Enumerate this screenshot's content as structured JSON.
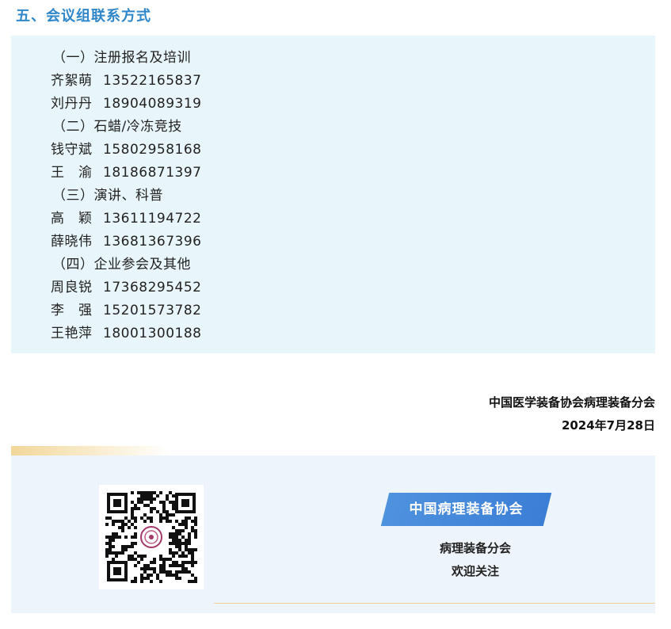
{
  "section_title": "五、会议组联系方式",
  "contacts": [
    {
      "type": "category",
      "text": "（一）注册报名及培训"
    },
    {
      "type": "person",
      "name": "齐絮萌",
      "phone": "13522165837"
    },
    {
      "type": "person",
      "name": "刘丹丹",
      "phone": "18904089319"
    },
    {
      "type": "category",
      "text": "（二）石蜡/冷冻竞技"
    },
    {
      "type": "person",
      "name": "钱守斌",
      "phone": "15802958168"
    },
    {
      "type": "person",
      "name": "王　渝",
      "phone": "18186871397"
    },
    {
      "type": "category",
      "text": "（三）演讲、科普"
    },
    {
      "type": "person",
      "name": "高　颖",
      "phone": "13611194722"
    },
    {
      "type": "person",
      "name": "薛晓伟",
      "phone": "13681367396"
    },
    {
      "type": "category",
      "text": "（四）企业参会及其他"
    },
    {
      "type": "person",
      "name": "周良锐",
      "phone": "17368295452"
    },
    {
      "type": "person",
      "name": "李　强",
      "phone": "15201573782"
    },
    {
      "type": "person",
      "name": "王艳萍",
      "phone": "18001300188"
    }
  ],
  "signature": {
    "organization": "中国医学装备协会病理装备分会",
    "date": "2024年7月28日"
  },
  "footer": {
    "badge": "中国病理装备协会",
    "line1": "病理装备分会",
    "line2": "欢迎关注"
  },
  "colors": {
    "title": "#2f86c8",
    "contact_bg": "#e8f6fb",
    "footer_bg": "#eef4fb",
    "badge": "#3a7ed6",
    "gold": "#f2d79a"
  },
  "icons": {
    "qr": "qr-code-icon",
    "logo": "society-logo-icon"
  }
}
